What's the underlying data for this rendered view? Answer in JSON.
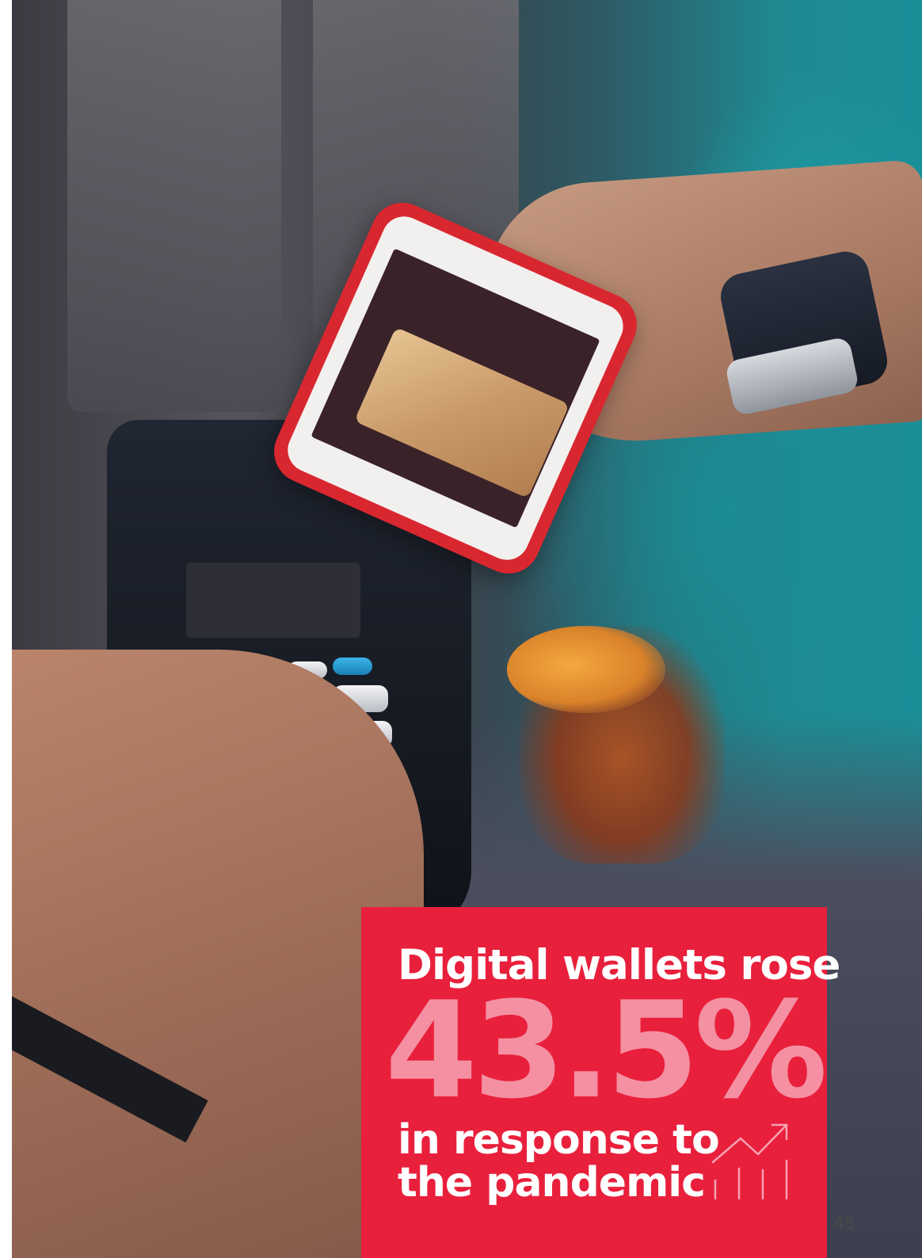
{
  "callout": {
    "headline": "Digital wallets rose",
    "stat": "43.5%",
    "subline_1": "in response to",
    "subline_2": "the pandemic"
  },
  "page": {
    "number": "45"
  },
  "colors": {
    "callout_bg": "#e8203c",
    "stat_text": "#f490a2",
    "text": "#ffffff"
  },
  "icons": {
    "growth": "growth-chart-icon"
  }
}
